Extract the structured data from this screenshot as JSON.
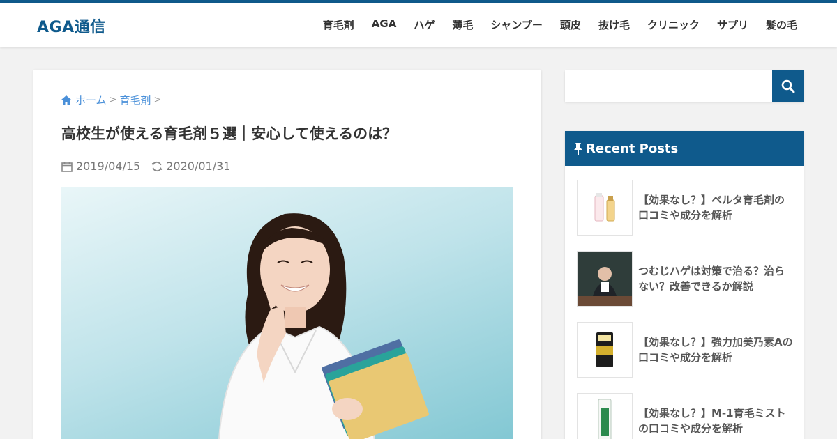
{
  "header": {
    "logo": "AGA通信",
    "nav": [
      "育毛剤",
      "AGA",
      "ハゲ",
      "薄毛",
      "シャンプー",
      "頭皮",
      "抜け毛",
      "クリニック",
      "サプリ",
      "髪の毛"
    ]
  },
  "article": {
    "breadcrumb": {
      "home": "ホーム",
      "category": "育毛剤"
    },
    "title": "高校生が使える育毛剤５選｜安心して使えるのは？",
    "published": "2019/04/15",
    "updated": "2020/01/31"
  },
  "search": {
    "placeholder": ""
  },
  "sidebar": {
    "widget_title": "Recent Posts",
    "posts": [
      {
        "title": "【効果なし？】ベルタ育毛剤の口コミや成分を解析"
      },
      {
        "title": "つむじハゲは対策で治る？治らない？改善できるか解説"
      },
      {
        "title": "【効果なし？】強力加美乃素Aの口コミや成分を解析"
      },
      {
        "title": "【効果なし？】M-1育毛ミストの口コミや成分を解析"
      }
    ]
  },
  "colors": {
    "brand": "#0f5a8c",
    "link": "#4a90d9"
  }
}
